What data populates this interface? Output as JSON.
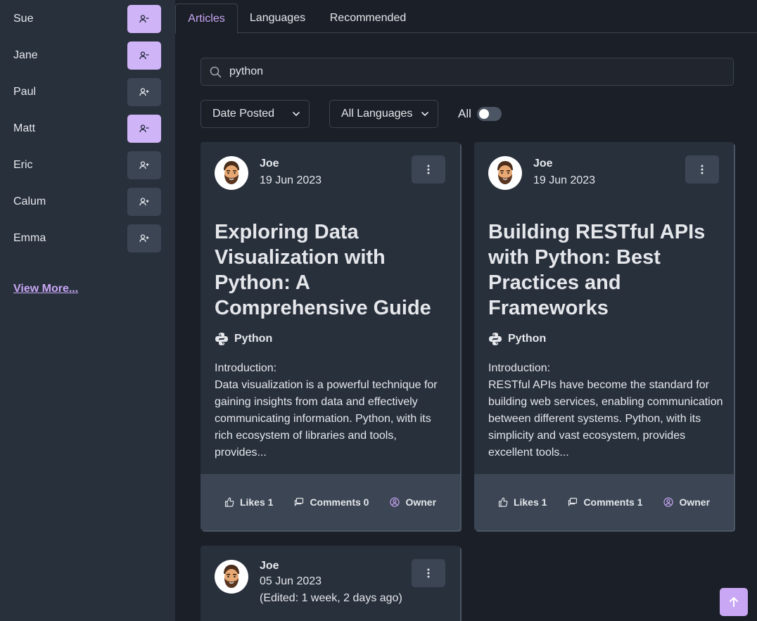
{
  "sidebar": {
    "users": [
      {
        "name": "Sue",
        "following": true
      },
      {
        "name": "Jane",
        "following": true
      },
      {
        "name": "Paul",
        "following": false
      },
      {
        "name": "Matt",
        "following": true
      },
      {
        "name": "Eric",
        "following": false
      },
      {
        "name": "Calum",
        "following": false
      },
      {
        "name": "Emma",
        "following": false
      }
    ],
    "view_more": "View More..."
  },
  "tabs": {
    "articles": "Articles",
    "languages": "Languages",
    "recommended": "Recommended"
  },
  "search": {
    "value": "python"
  },
  "filters": {
    "sort": "Date Posted",
    "language": "All Languages",
    "toggle_label": "All",
    "toggle_on": false
  },
  "articles": [
    {
      "author": "Joe",
      "date": "19 Jun 2023",
      "title": "Exploring Data Visualization with Python: A Comprehensive Guide",
      "language": "Python",
      "intro": "Introduction:",
      "excerpt": "Data visualization is a powerful technique for gaining insights from data and effectively communicating information. Python, with its rich ecosystem of libraries and tools, provides...",
      "likes": "Likes 1",
      "comments": "Comments 0",
      "owner": "Owner"
    },
    {
      "author": "Joe",
      "date": "19 Jun 2023",
      "title": "Building RESTful APIs with Python: Best Practices and Frameworks",
      "language": "Python",
      "intro": "Introduction:",
      "excerpt": "RESTful APIs have become the standard for building web services, enabling communication between different systems. Python, with its simplicity and vast ecosystem, provides excellent tools...",
      "likes": "Likes 1",
      "comments": "Comments 1",
      "owner": "Owner"
    },
    {
      "author": "Joe",
      "date": "05 Jun 2023",
      "edited": "(Edited: 1 week, 2 days ago)"
    }
  ],
  "colors": {
    "accent": "#c9a7f5",
    "background": "#1b1f27",
    "sidebar": "#28303c",
    "card_footer": "#3b4554"
  },
  "icons": {
    "follow": "user-plus-icon",
    "unfollow": "user-minus-icon",
    "search": "search-icon",
    "chevron": "chevron-down-icon",
    "menu": "kebab-menu-icon",
    "language": "python-logo-icon",
    "likes": "thumbs-up-icon",
    "comments": "comments-icon",
    "owner": "user-circle-icon",
    "to_top": "arrow-up-icon"
  }
}
